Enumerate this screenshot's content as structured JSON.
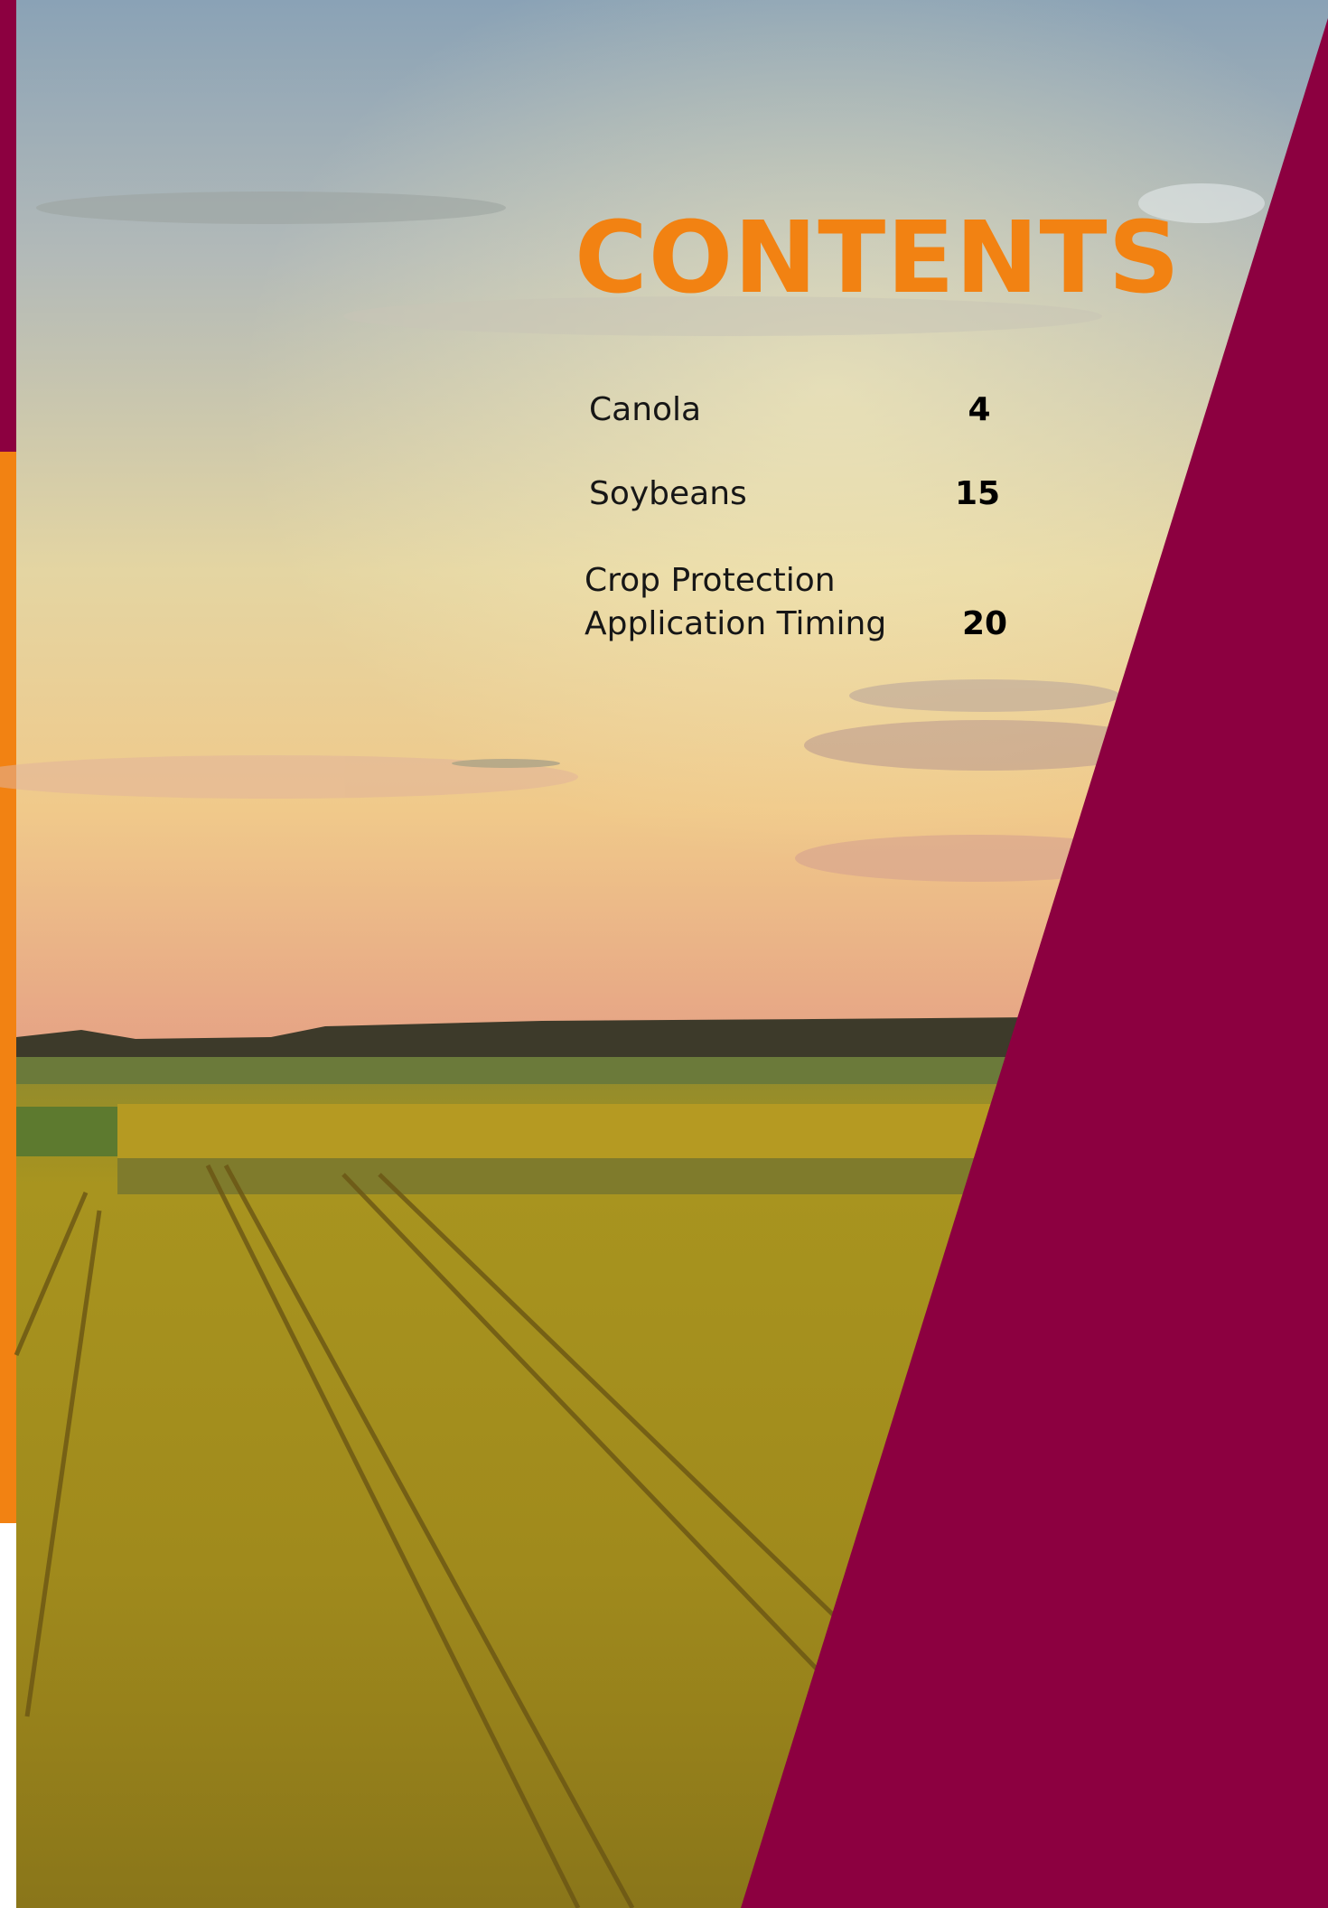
{
  "title": "CONTENTS",
  "colors": {
    "accent_orange": "#F28212",
    "accent_maroon": "#8C0040",
    "text_dark": "#161616",
    "sky_top": "#8FA6B8",
    "sky_horizon": "#F2C98A",
    "field": "#A89422"
  },
  "toc": [
    {
      "label_lines": [
        "Canola"
      ],
      "page": "4"
    },
    {
      "label_lines": [
        "Soybeans"
      ],
      "page": "15"
    },
    {
      "label_lines": [
        "Crop Protection",
        "Application Timing"
      ],
      "page": "20"
    }
  ]
}
